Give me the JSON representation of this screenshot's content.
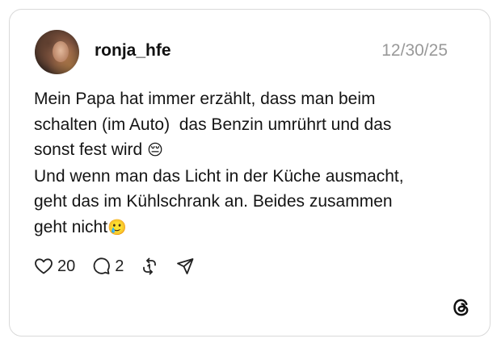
{
  "post": {
    "username": "ronja_hfe",
    "date": "12/30/25",
    "lines": [
      "Mein Papa hat immer erzählt, dass man beim",
      "schalten (im Auto)  das Benzin umrührt und das",
      "sonst fest wird ",
      "Und wenn man das Licht in der Küche ausmacht,",
      "geht das im Kühlschrank an. Beides zusammen",
      "geht nicht"
    ],
    "emoji_1": "😔",
    "emoji_2": "🥲"
  },
  "actions": {
    "like_count": "20",
    "reply_count": "2"
  },
  "icons": {
    "like": "heart-icon",
    "reply": "comment-icon",
    "repost": "repost-icon",
    "share": "send-icon",
    "brand": "threads-logo-icon"
  }
}
